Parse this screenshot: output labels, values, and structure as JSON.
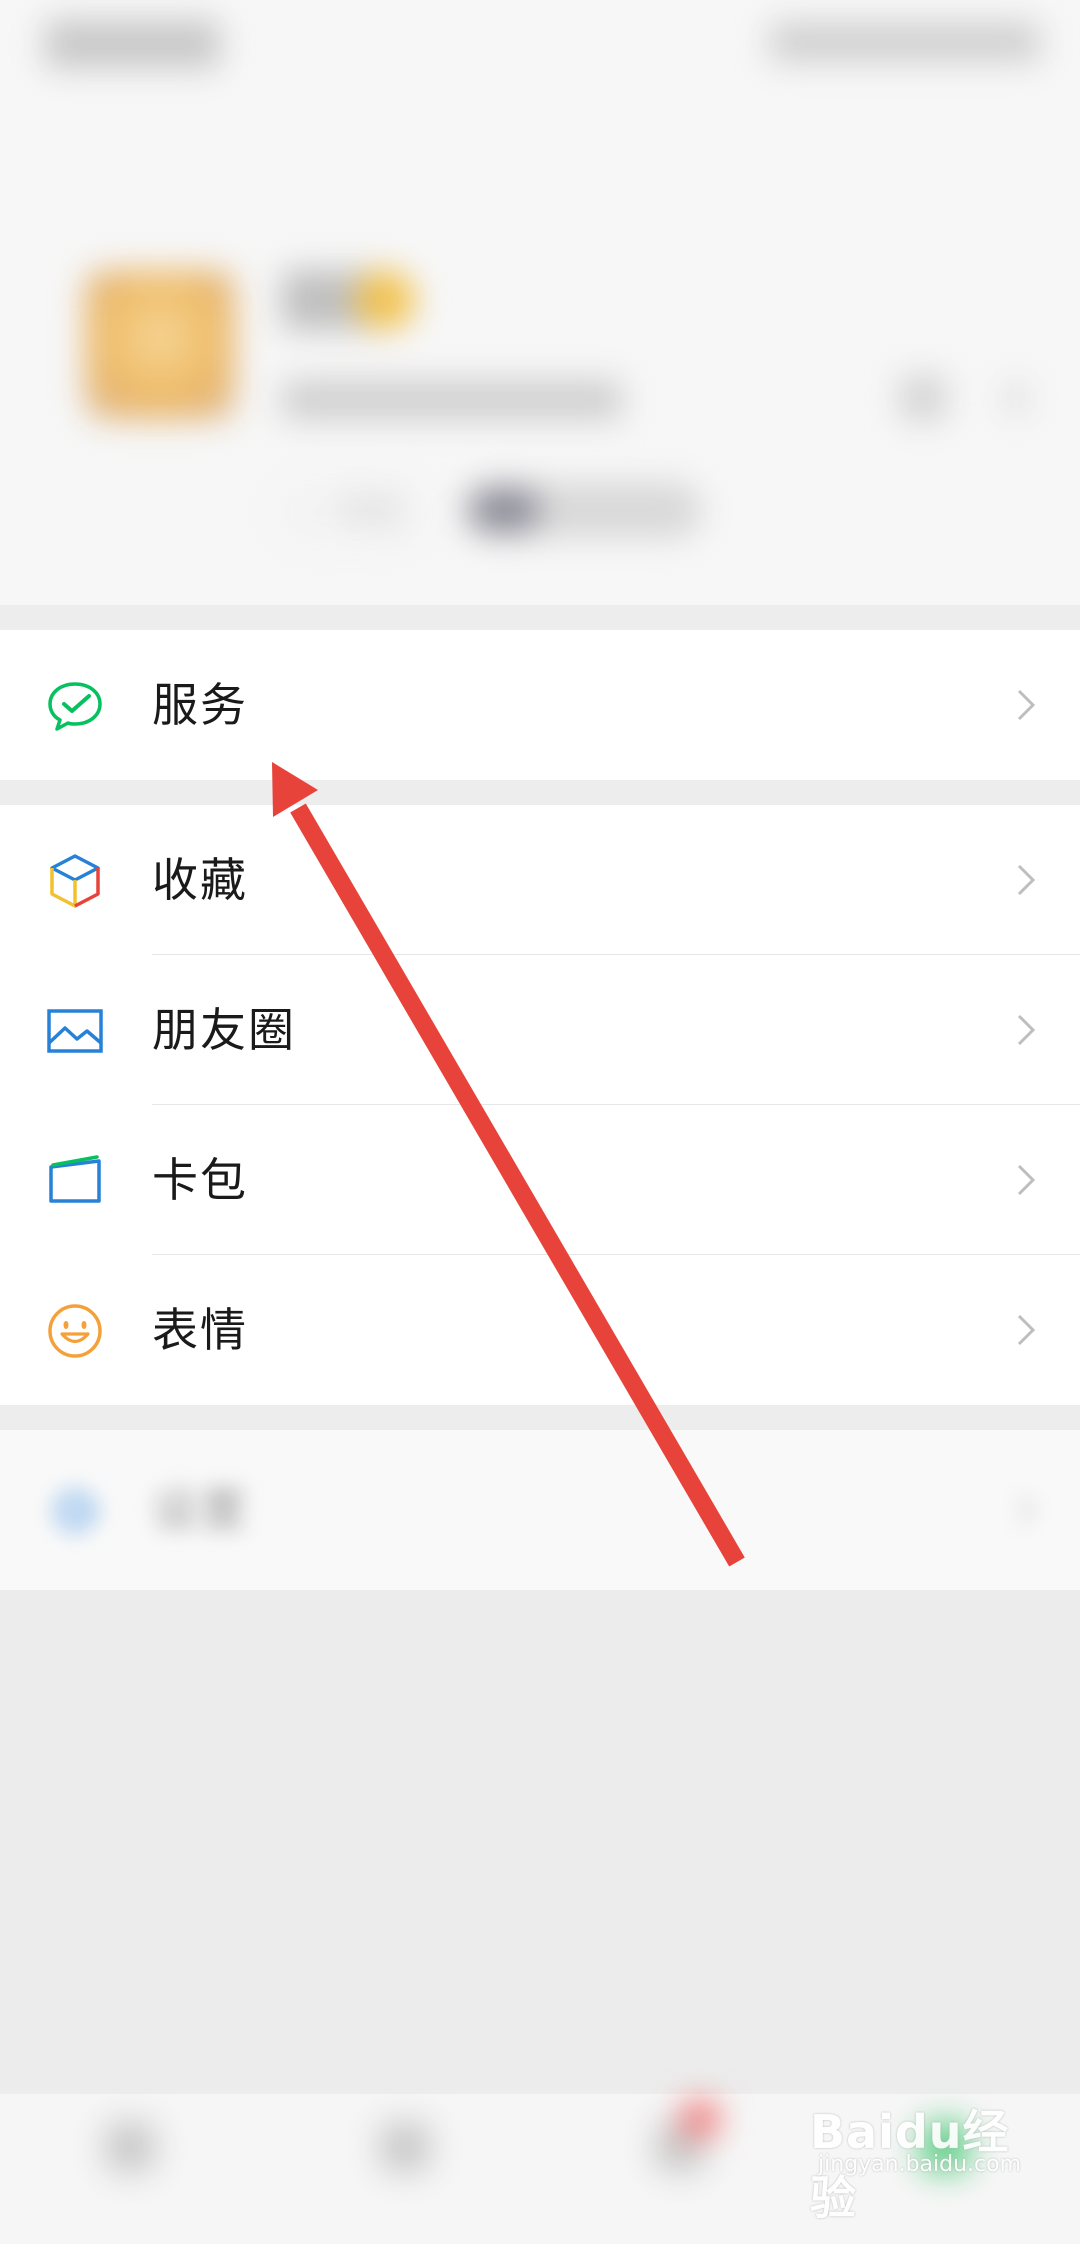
{
  "profile": {
    "status_button_label": "+ 状态"
  },
  "menu": {
    "service": {
      "label": "服务",
      "icon": "wechat-pay-icon",
      "color": "#07c160"
    },
    "items": [
      {
        "label": "收藏",
        "icon": "favorites-cube-icon"
      },
      {
        "label": "朋友圈",
        "icon": "moments-picture-icon",
        "color": "#2782d7"
      },
      {
        "label": "卡包",
        "icon": "card-wallet-icon",
        "color": "#2782d7"
      },
      {
        "label": "表情",
        "icon": "sticker-smile-icon",
        "color": "#f5a13a"
      }
    ],
    "settings": {
      "label": "设置",
      "icon": "gear-icon",
      "color": "#2782d7"
    }
  },
  "annotation": {
    "color": "#e8433a",
    "points_to": "服务"
  },
  "watermark": {
    "main": "Baidu经验",
    "sub": "jingyan.baidu.com"
  }
}
